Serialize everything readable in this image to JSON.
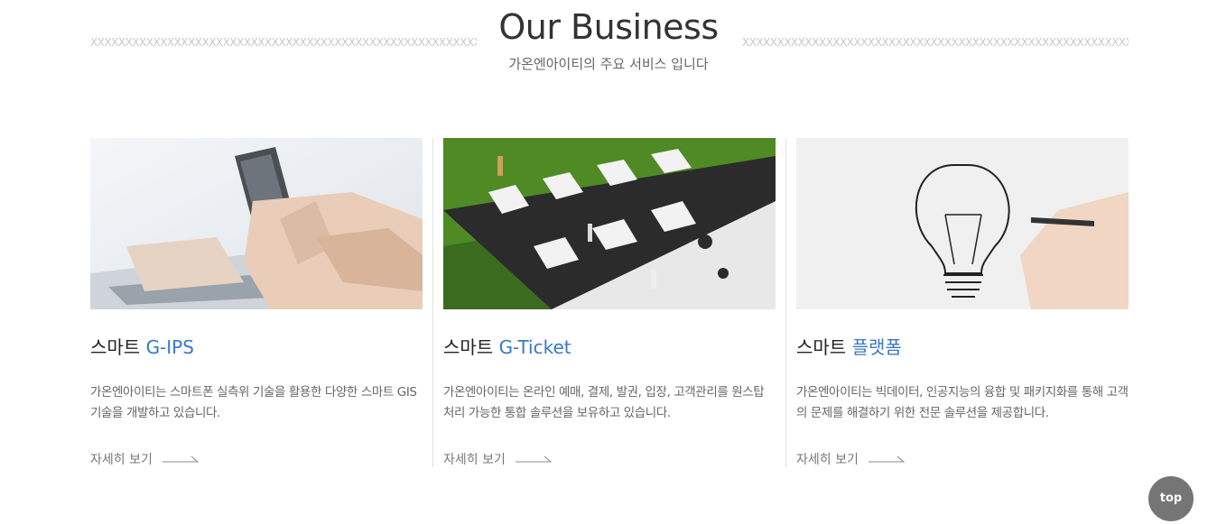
{
  "header": {
    "title": "Our Business",
    "subtitle": "가온엔아이티의 주요 서비스 입니다",
    "pattern_text": "XXXXXXXXXXXXXXXXXXXXXXXXXXXXXXXXXXXXXXXXXXXXXXXXXXXXXXXXXXXXXXXXXXXXXXXX"
  },
  "cards": [
    {
      "title_prefix": "스마트",
      "title_accent": "G-IPS",
      "description": "가온엔아이티는 스마트폰 실측위 기술을 활용한 다양한 스마트 GIS기술을 개발하고 있습니다.",
      "more_label": "자세히 보기",
      "image_icon": "smartphone-hands-photo"
    },
    {
      "title_prefix": "스마트",
      "title_accent": "G-Ticket",
      "description": "가온엔아이티는 온라인 예매, 결제, 발권, 입장, 고객관리를 원스탑 처리 가능한 통합 솔루션을 보유하고 있습니다.",
      "more_label": "자세히 보기",
      "image_icon": "clapperboard-miniatures-photo"
    },
    {
      "title_prefix": "스마트",
      "title_accent": "플랫폼",
      "description": "가온엔아이티는 빅데이터, 인공지능의 융합 및 패키지화를 통해 고객의 문제를 해결하기 위한 전문 솔루션을 제공합니다.",
      "more_label": "자세히 보기",
      "image_icon": "lightbulb-drawing-photo"
    }
  ],
  "top_button": {
    "label": "top"
  },
  "colors": {
    "accent": "#3a78c2",
    "top_button_bg": "#757575"
  }
}
